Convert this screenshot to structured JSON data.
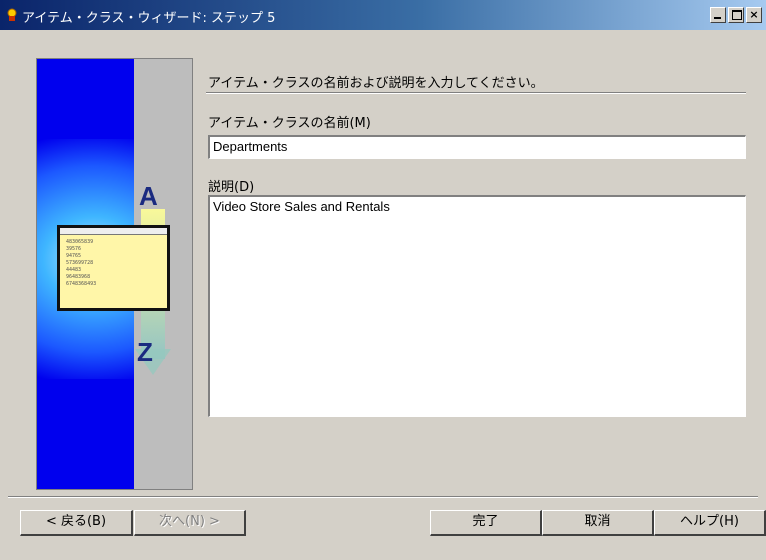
{
  "window": {
    "title": "アイテム・クラス・ウィザード: ステップ 5",
    "controls": {
      "minimize": "_",
      "maximize": "□",
      "close": "×"
    }
  },
  "illustration": {
    "letter_top": "A",
    "letter_bottom": "Z",
    "card_lines": [
      "483065839",
      "39576",
      "94765",
      "573699728",
      "44483",
      "96483968",
      "6748368493"
    ]
  },
  "main": {
    "instruction": "アイテム・クラスの名前および説明を入力してください。",
    "name_label": "アイテム・クラスの名前(M)",
    "name_value": "Departments",
    "description_label": "説明(D)",
    "description_value": "Video Store Sales and Rentals"
  },
  "buttons": {
    "back": "< 戻る(B)",
    "next": "次へ(N) >",
    "finish": "完了",
    "cancel": "取消",
    "help": "ヘルプ(H)"
  }
}
